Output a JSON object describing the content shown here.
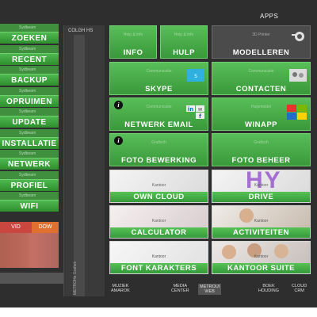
{
  "header": {
    "apps_title": "APPS"
  },
  "sidebar": {
    "items": [
      {
        "sub": "Sydbeam",
        "label": "ZOEKEN"
      },
      {
        "sub": "Sydbeam",
        "label": "RECENT"
      },
      {
        "sub": "Sydbeam",
        "label": "BACKUP"
      },
      {
        "sub": "Sydbeam",
        "label": "OPRUIMEN"
      },
      {
        "sub": "Sydbeam",
        "label": "UPDATE"
      },
      {
        "sub": "Sydbeam",
        "label": "INSTALLATIE"
      },
      {
        "sub": "Sydbeam",
        "label": "NETWERK"
      },
      {
        "sub": "Sydbeam",
        "label": "PROFIEL"
      },
      {
        "sub": "Sydbeam",
        "label": "WIFI"
      }
    ],
    "vid": "VID",
    "dow": "DOW"
  },
  "column": {
    "heading": "COLGH HS",
    "vertical": "METROHe Grafiek"
  },
  "tiles": {
    "info": {
      "sub": "Help & info",
      "label": "INFO"
    },
    "hulp": {
      "sub": "Help & info",
      "label": "HULP"
    },
    "modelleren": {
      "sub": "3D Printer",
      "label": "MODELLEREN"
    },
    "skype": {
      "sub": "Communicatie",
      "label": "SKYPE"
    },
    "contacten": {
      "sub": "Communicatie",
      "label": "CONTACTEN"
    },
    "netwerk_email": {
      "sub": "Communicatie",
      "label": "NETWERK EMAIL"
    },
    "winapp": {
      "sub": "Hulpmiddel",
      "label": "WINAPP"
    },
    "foto_bewerking": {
      "sub": "Grafisch",
      "label": "FOTO BEWERKING"
    },
    "foto_beheer": {
      "sub": "Grafisch",
      "label": "FOTO BEHEER"
    },
    "own_cloud": {
      "sub": "Kantoor",
      "label": "OWN CLOUD"
    },
    "drive": {
      "sub": "Kantoor",
      "label": "DRIVE",
      "bg_text": "HY"
    },
    "calculator": {
      "sub": "Kantoor",
      "label": "CALCULATOR"
    },
    "activiteiten": {
      "sub": "Kantoor",
      "label": "ACTIVITEITEN"
    },
    "font_karakters": {
      "sub": "Kantoor",
      "label": "FONT KARAKTERS"
    },
    "kantoor_suite": {
      "sub": "Kantoor",
      "label": "KANTOOR SUITE"
    }
  },
  "dock": [
    {
      "line1": "MUZIEK",
      "line2": "AMAROK"
    },
    {
      "line1": "MEDIA",
      "line2": "CENTER"
    },
    {
      "line1": "METROUI",
      "line2": "WEB"
    },
    {
      "line1": "BOEK",
      "line2": "HOUDING"
    },
    {
      "line1": "CLOUD",
      "line2": "CRM"
    }
  ],
  "colors": {
    "accent_green": "#3fa53f",
    "background": "#2e2e2e"
  }
}
